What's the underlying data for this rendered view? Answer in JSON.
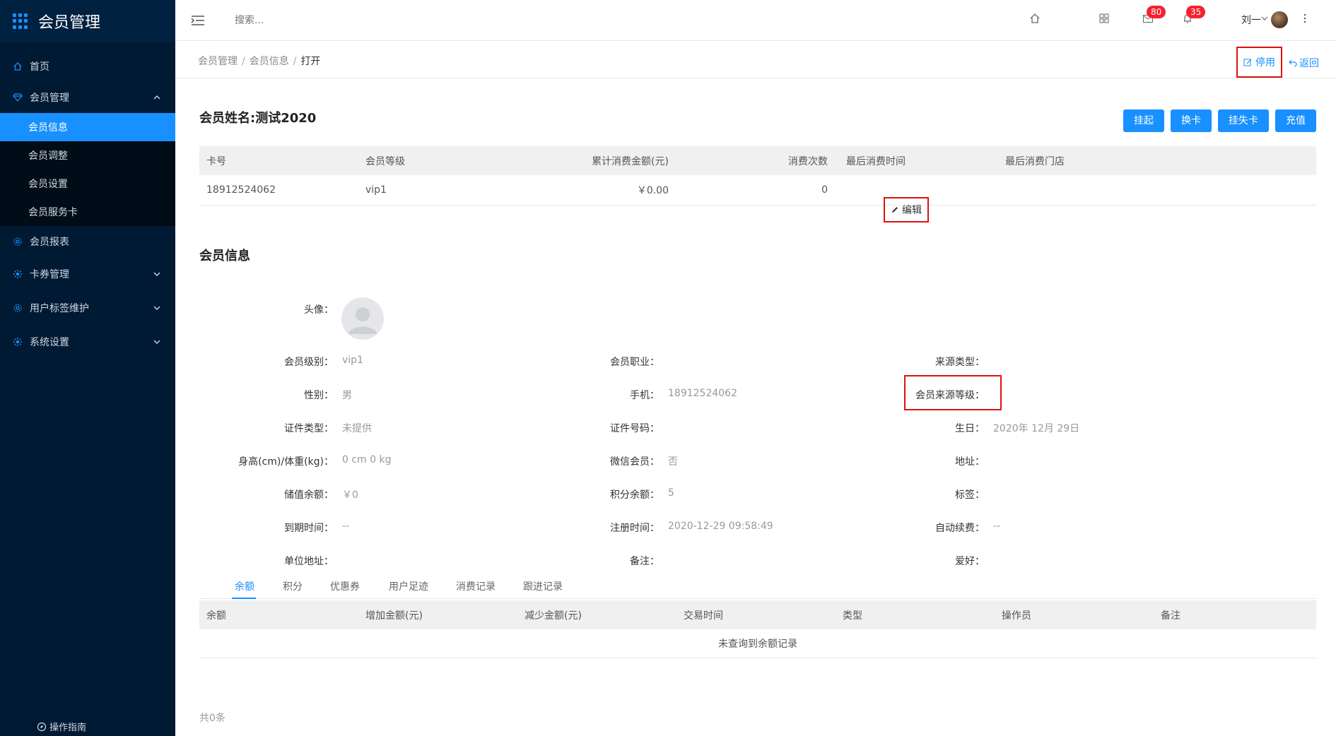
{
  "sidebar": {
    "title": "会员管理",
    "items": [
      {
        "label": "首页"
      },
      {
        "label": "会员管理"
      },
      {
        "label": "会员报表"
      },
      {
        "label": "卡券管理"
      },
      {
        "label": "用户标签维护"
      },
      {
        "label": "系统设置"
      }
    ],
    "sub_items": [
      {
        "label": "会员信息"
      },
      {
        "label": "会员调整"
      },
      {
        "label": "会员设置"
      },
      {
        "label": "会员服务卡"
      }
    ],
    "guide": "操作指南"
  },
  "header": {
    "search_placeholder": "搜索...",
    "mail_badge": "80",
    "bell_badge": "35",
    "user": "刘一"
  },
  "breadcrumb": {
    "a": "会员管理",
    "b": "会员信息",
    "c": "打开"
  },
  "actions": {
    "disable": "停用",
    "back": "返回"
  },
  "member": {
    "name": "会员姓名:测试2020",
    "buttons": [
      "挂起",
      "换卡",
      "挂失卡",
      "充值"
    ]
  },
  "card_table": {
    "headers": [
      "卡号",
      "会员等级",
      "累计消费金额(元)",
      "消费次数",
      "最后消费时间",
      "最后消费门店"
    ],
    "row": [
      "18912524062",
      "vip1",
      "￥0.00",
      "0",
      "",
      ""
    ]
  },
  "info": {
    "title": "会员信息",
    "edit": "编辑",
    "avatar_label": "头像：",
    "fields": [
      {
        "label": "会员级别：",
        "value": "vip1"
      },
      {
        "label": "会员职业：",
        "value": ""
      },
      {
        "label": "来源类型：",
        "value": ""
      },
      {
        "label": "性别：",
        "value": "男"
      },
      {
        "label": "手机：",
        "value": "18912524062"
      },
      {
        "label": "会员来源等级：",
        "value": ""
      },
      {
        "label": "证件类型：",
        "value": "未提供"
      },
      {
        "label": "证件号码：",
        "value": ""
      },
      {
        "label": "生日：",
        "value": "2020年 12月 29日"
      },
      {
        "label": "身高(cm)/体重(kg)：",
        "value": "0 cm 0 kg"
      },
      {
        "label": "微信会员：",
        "value": "否"
      },
      {
        "label": "地址：",
        "value": ""
      },
      {
        "label": "储值余额：",
        "value": "￥0"
      },
      {
        "label": "积分余额：",
        "value": "5"
      },
      {
        "label": "标签：",
        "value": ""
      },
      {
        "label": "到期时间：",
        "value": "--"
      },
      {
        "label": "注册时间：",
        "value": "2020-12-29 09:58:49"
      },
      {
        "label": "自动续费：",
        "value": "--"
      },
      {
        "label": "单位地址：",
        "value": ""
      },
      {
        "label": "备注：",
        "value": ""
      },
      {
        "label": "爱好：",
        "value": ""
      }
    ]
  },
  "tabs": [
    "余额",
    "积分",
    "优惠券",
    "用户足迹",
    "消费记录",
    "跟进记录"
  ],
  "record_table": {
    "headers": [
      "余额",
      "增加金额(元)",
      "减少金额(元)",
      "交易时间",
      "类型",
      "操作员",
      "备注"
    ],
    "empty": "未查询到余额记录"
  },
  "total": "共0条",
  "colors": {
    "primary": "#1890ff",
    "sidebar": "#001a33",
    "highlight": "#e01010"
  }
}
